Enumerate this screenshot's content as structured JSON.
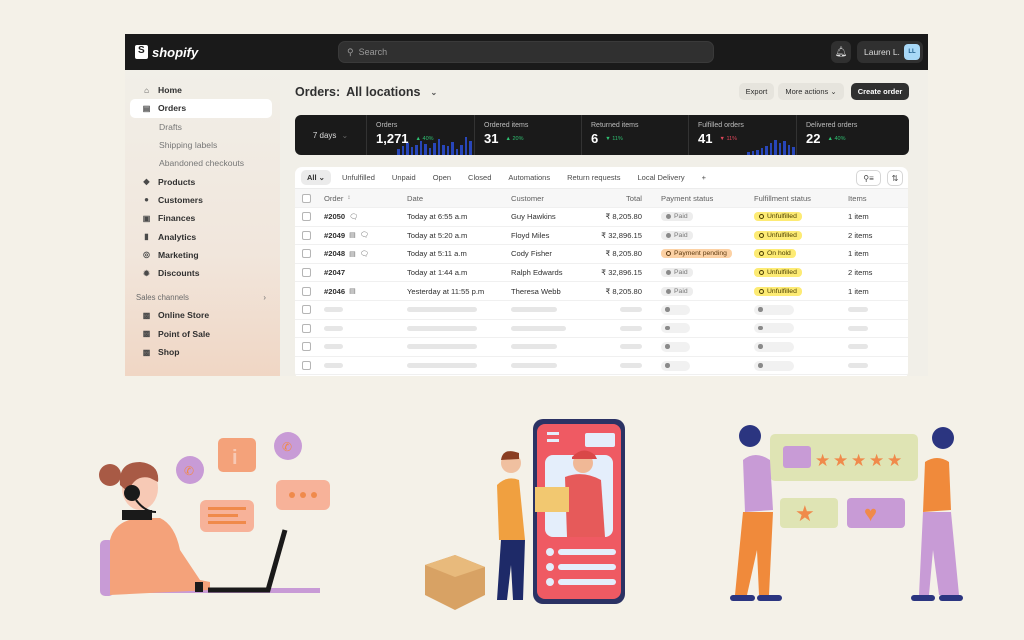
{
  "topbar": {
    "brand": "shopify",
    "search_placeholder": "Search",
    "user_name": "Lauren L.",
    "user_initials": "LL"
  },
  "sidebar": {
    "items": [
      {
        "label": "Home",
        "icon": "home-icon"
      },
      {
        "label": "Orders",
        "icon": "inbox-icon",
        "active": true
      },
      {
        "label": "Drafts",
        "sub": true
      },
      {
        "label": "Shipping labels",
        "sub": true
      },
      {
        "label": "Abandoned checkouts",
        "sub": true
      },
      {
        "label": "Products",
        "icon": "tag-icon"
      },
      {
        "label": "Customers",
        "icon": "person-icon"
      },
      {
        "label": "Finances",
        "icon": "bank-icon"
      },
      {
        "label": "Analytics",
        "icon": "bar-chart-icon"
      },
      {
        "label": "Marketing",
        "icon": "target-icon"
      },
      {
        "label": "Discounts",
        "icon": "discount-icon"
      }
    ],
    "sales_channels_label": "Sales channels",
    "channels": [
      {
        "label": "Online Store",
        "icon": "store-icon"
      },
      {
        "label": "Point of Sale",
        "icon": "pos-icon"
      },
      {
        "label": "Shop",
        "icon": "shop-icon"
      }
    ]
  },
  "page": {
    "title_prefix": "Orders:",
    "title_location": "All locations",
    "export_label": "Export",
    "more_actions_label": "More actions",
    "create_order_label": "Create order"
  },
  "stats": {
    "period": "7 days",
    "cards": [
      {
        "label": "Orders",
        "value": "1,271",
        "change": "40%",
        "direction": "up"
      },
      {
        "label": "Ordered items",
        "value": "31",
        "change": "20%",
        "direction": "up"
      },
      {
        "label": "Returned items",
        "value": "6",
        "change": "11%",
        "direction": "down"
      },
      {
        "label": "Fulfilled orders",
        "value": "41",
        "change": "11%",
        "direction": "down"
      },
      {
        "label": "Delivered orders",
        "value": "22",
        "change": "40%",
        "direction": "up"
      }
    ]
  },
  "filters": {
    "tabs": [
      "All",
      "Unfulfilled",
      "Unpaid",
      "Open",
      "Closed",
      "Automations",
      "Return requests",
      "Local Delivery",
      "+"
    ]
  },
  "table": {
    "headers": {
      "order": "Order",
      "date": "Date",
      "customer": "Customer",
      "total": "Total",
      "payment": "Payment status",
      "fulfillment": "Fulfillment status",
      "items": "Items"
    },
    "rows": [
      {
        "order": "#2050",
        "icons": [
          "comment-icon"
        ],
        "date": "Today at 6:55 a.m",
        "customer": "Guy Hawkins",
        "total": "₹ 8,205.80",
        "payment": "Paid",
        "fulfillment": "Unfulfilled",
        "items": "1 item"
      },
      {
        "order": "#2049",
        "icons": [
          "note-icon",
          "comment-icon"
        ],
        "date": "Today at 5:20 a.m",
        "customer": "Floyd Miles",
        "total": "₹ 32,896.15",
        "payment": "Paid",
        "fulfillment": "Unfulfilled",
        "items": "2 items"
      },
      {
        "order": "#2048",
        "icons": [
          "note-icon",
          "comment-icon"
        ],
        "date": "Today at 5:11 a.m",
        "customer": "Cody Fisher",
        "total": "₹ 8,205.80",
        "payment": "Payment pending",
        "fulfillment": "On hold",
        "items": "1 item"
      },
      {
        "order": "#2047",
        "icons": [],
        "date": "Today at 1:44 a.m",
        "customer": "Ralph Edwards",
        "total": "₹ 32,896.15",
        "payment": "Paid",
        "fulfillment": "Unfulfilled",
        "items": "2 items"
      },
      {
        "order": "#2046",
        "icons": [
          "note-icon"
        ],
        "date": "Yesterday at 11:55 p.m",
        "customer": "Theresa Webb",
        "total": "₹ 8,205.80",
        "payment": "Paid",
        "fulfillment": "Unfulfilled",
        "items": "1 item"
      }
    ],
    "skeleton_rows": 4
  },
  "illustrations": [
    {
      "name": "customer-support-illustration"
    },
    {
      "name": "delivery-handoff-illustration"
    },
    {
      "name": "five-star-review-illustration"
    }
  ]
}
